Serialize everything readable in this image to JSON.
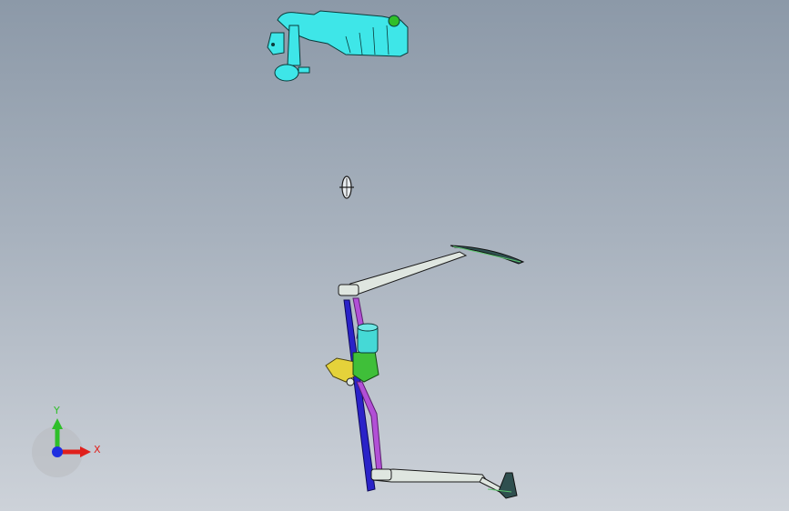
{
  "viewport": {
    "background_top": "#8c99a8",
    "background_bottom": "#cdd2d9"
  },
  "triad": {
    "x_label": "X",
    "y_label": "Y",
    "x_color": "#e0201c",
    "y_color": "#2fbf2a",
    "z_color": "#1f2fe0"
  },
  "parts": {
    "reservoir_color": "#3ee6e8",
    "linkage_color": "#2a22c8",
    "rod_color": "#b24fd6",
    "motor_color": "#45d9d6",
    "gearbox_color": "#3fbf39",
    "bracket_color": "#e5d23a",
    "wiper_arm_color": "#dfe6e0",
    "wiper_blade_color": "#2f4f4f"
  }
}
